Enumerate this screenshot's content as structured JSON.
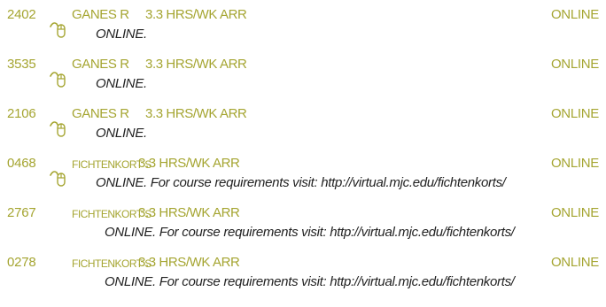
{
  "colors": {
    "accent": "#a5a531",
    "text": "#222222"
  },
  "courses": [
    {
      "sec": "2402",
      "instructor": "GANES R",
      "hours": "3.3 HRS/WK ARR",
      "location": "ONLINE",
      "note": "ONLINE.",
      "icon": "mouse-icon"
    },
    {
      "sec": "3535",
      "instructor": "GANES R",
      "hours": "3.3 HRS/WK ARR",
      "location": "ONLINE",
      "note": "ONLINE.",
      "icon": "mouse-icon"
    },
    {
      "sec": "2106",
      "instructor": "GANES R",
      "hours": "3.3 HRS/WK ARR",
      "location": "ONLINE",
      "note": "ONLINE.",
      "icon": "mouse-icon"
    },
    {
      "sec": "0468",
      "instructor": "FICHTENKORT S",
      "hours": "3.3 HRS/WK ARR",
      "location": "ONLINE",
      "note": "ONLINE. For course requirements visit: http://virtual.mjc.edu/fichtenkorts/",
      "icon": "mouse-icon"
    },
    {
      "sec": "2767",
      "instructor": "FICHTENKORT S",
      "hours": "3.3 HRS/WK ARR",
      "location": "ONLINE",
      "note": "ONLINE. For course requirements visit: http://virtual.mjc.edu/fichtenkorts/"
    },
    {
      "sec": "0278",
      "instructor": "FICHTENKORT S",
      "hours": "3.3 HRS/WK ARR",
      "location": "ONLINE",
      "note": "ONLINE. For course requirements visit: http://virtual.mjc.edu/fichtenkorts/"
    }
  ]
}
